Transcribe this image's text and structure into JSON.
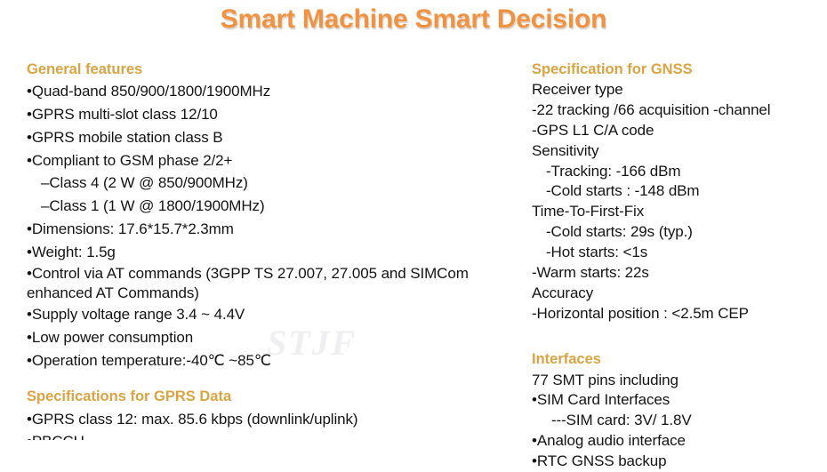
{
  "title": "Smart Machine Smart Decision",
  "watermark": "STJF",
  "colors": {
    "title": "#F2923F",
    "heading": "#D9A441",
    "body": "#141414",
    "background": "#FFFFFF",
    "watermark": "#EFEFF1"
  },
  "left_column": {
    "sections": [
      {
        "heading": "General features",
        "lines": [
          "•Quad-band 850/900/1800/1900MHz",
          "•GPRS multi-slot class 12/10",
          "•GPRS mobile station class B",
          "•Compliant to GSM phase 2/2+",
          "–Class 4 (2 W @ 850/900MHz)",
          "–Class 1 (1 W @ 1800/1900MHz)",
          "•Dimensions: 17.6*15.7*2.3mm",
          "•Weight: 1.5g",
          "•Control via AT commands (3GPP TS 27.007, 27.005 and SIMCom enhanced AT Commands)",
          "•Supply voltage range 3.4 ~ 4.4V",
          "•Low power consumption",
          "•Operation temperature:-40℃ ~85℃"
        ]
      },
      {
        "heading": "Specifications for GPRS Data",
        "lines": [
          "•GPRS class 12: max. 85.6 kbps (downlink/uplink)",
          "•PBCCH"
        ]
      }
    ]
  },
  "right_column": {
    "sections": [
      {
        "heading": "Specification for GNSS",
        "lines": [
          "Receiver type",
          "-22 tracking /66 acquisition -channel",
          "-GPS L1 C/A code",
          "Sensitivity",
          "-Tracking: -166 dBm",
          "-Cold starts : -148 dBm",
          "Time-To-First-Fix",
          "-Cold starts: 29s (typ.)",
          "-Hot starts: <1s",
          "-Warm starts:  22s",
          "Accuracy",
          "-Horizontal position : <2.5m CEP"
        ]
      },
      {
        "heading": "Interfaces",
        "lines": [
          "77 SMT pins including",
          "•SIM Card Interfaces",
          "---SIM card: 3V/ 1.8V",
          "•Analog audio interface",
          "•RTC GNSS backup"
        ]
      }
    ]
  }
}
